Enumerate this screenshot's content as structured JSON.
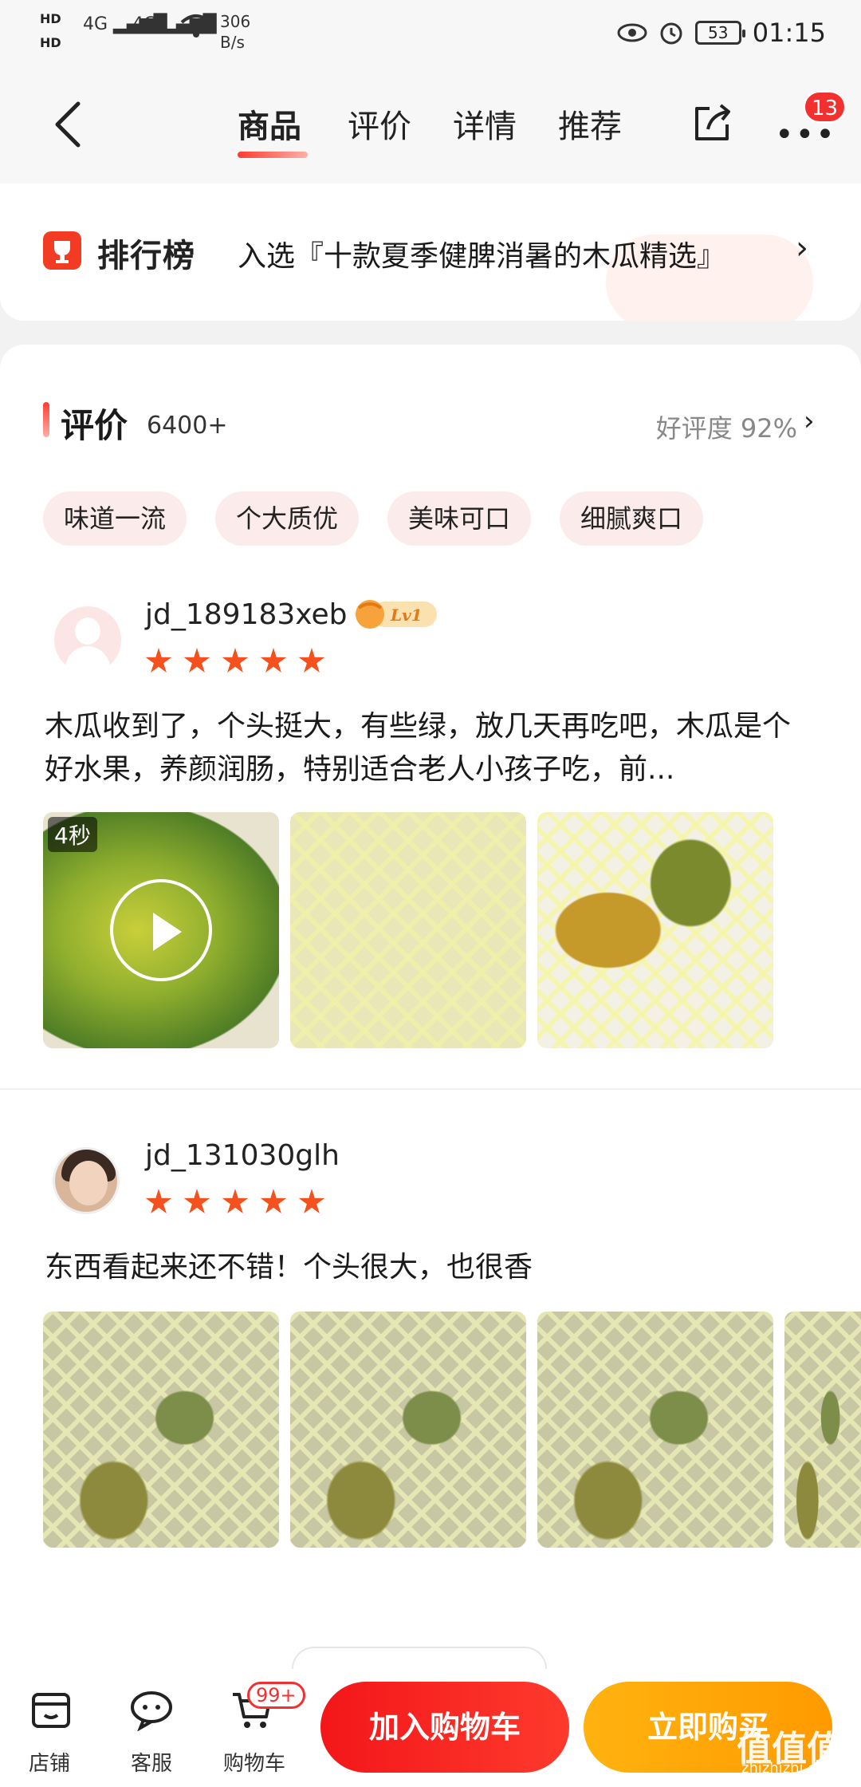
{
  "status_bar": {
    "hd1": "HD",
    "hd2": "HD",
    "net1": "4G",
    "net2": "4G",
    "speed_value": "306",
    "speed_unit": "B/s",
    "battery": "53",
    "time": "01:15"
  },
  "nav": {
    "tabs": [
      "商品",
      "评价",
      "详情",
      "推荐"
    ],
    "more_badge": "13"
  },
  "ranking": {
    "label": "排行榜",
    "text": "入选『十款夏季健脾消暑的木瓜精选』",
    "arrow": "›"
  },
  "reviews_section": {
    "title": "评价",
    "count": "6400+",
    "rating": "好评度 92%",
    "arrow": "›",
    "tags": [
      "味道一流",
      "个大质优",
      "美味可口",
      "细腻爽口"
    ]
  },
  "reviews": [
    {
      "user": "jd_189183xeb",
      "level": "Lv1",
      "text": "木瓜收到了，个头挺大，有些绿，放几天再吃吧，木瓜是个好水果，养颜润肠，特别适合老人小孩子吃，前...",
      "video_duration": "4秒"
    },
    {
      "user": "jd_131030glh",
      "text": "东西看起来还不错！个头很大，也很香"
    }
  ],
  "bottom_bar": {
    "store": "店铺",
    "service": "客服",
    "cart": "购物车",
    "cart_badge": "99+",
    "add_to_cart": "加入购物车",
    "buy_now": "立即购买",
    "watermark": "值值值",
    "watermark_sub": "zhizhizhi.com"
  },
  "colors": {
    "accent_red": "#f23030",
    "star": "#f4511e",
    "buy_orange": "#ffa200",
    "chip_bg": "#fbeceb"
  }
}
